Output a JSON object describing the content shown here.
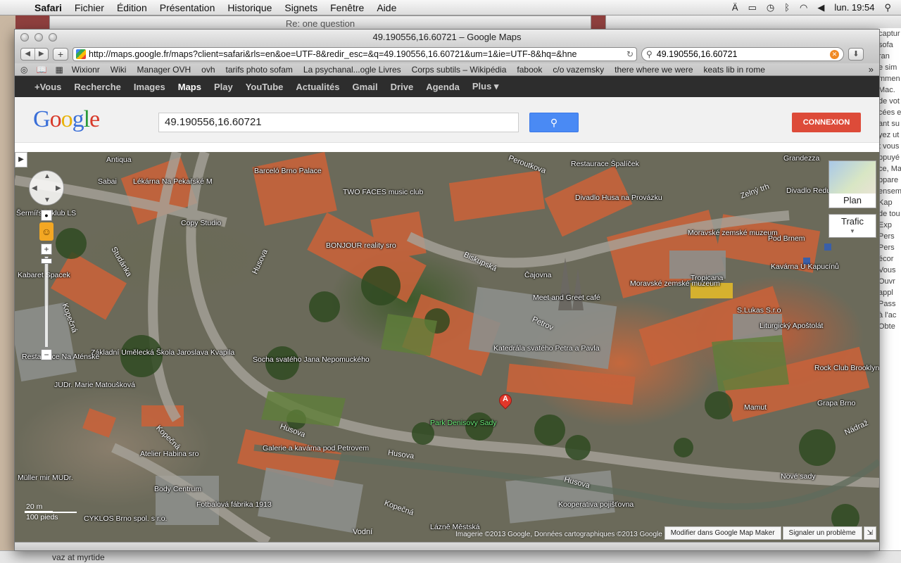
{
  "menubar": {
    "apple": "",
    "items": [
      "Safari",
      "Fichier",
      "Édition",
      "Présentation",
      "Historique",
      "Signets",
      "Fenêtre",
      "Aide"
    ],
    "clock": "lun. 19:54"
  },
  "background": {
    "mid_window_title": "Re: one question",
    "side_text": [
      "captur",
      "sofa",
      "ran",
      "e sim",
      "mmen",
      "Mac.",
      "de vot",
      "cées e",
      "ant su",
      "yez ut",
      "t vous",
      "ppuyé",
      "ce, Ma",
      "ppare",
      "ensemb",
      "Kap",
      "de tou",
      "Exp",
      "Pers",
      "Pers",
      "écor",
      "Vous",
      "Ouvr",
      "appl",
      "Pass",
      "à l'ac",
      "Obte"
    ],
    "bottom_item": "vaz at myrtide"
  },
  "window": {
    "title": "49.190556,16.60721 – Google Maps",
    "url": "http://maps.google.fr/maps?client=safari&rls=en&oe=UTF-8&redir_esc=&q=49.190556,16.60721&um=1&ie=UTF-8&hq=&hne",
    "search_field": "49.190556,16.60721",
    "bookmarks": [
      "Wixionr",
      "Wiki",
      "Manager OVH",
      "ovh",
      "tarifs photo sofam",
      "La psychanal...ogle Livres",
      "Corps subtils – Wikipédia",
      "fabook",
      "c/o vazemsky",
      "there where we were",
      "keats lib in rome"
    ]
  },
  "google_bar": {
    "items": [
      "+Vous",
      "Recherche",
      "Images",
      "Maps",
      "Play",
      "YouTube",
      "Actualités",
      "Gmail",
      "Drive",
      "Agenda",
      "Plus ▾"
    ],
    "active": "Maps"
  },
  "google_header": {
    "logo": "Google",
    "query": "49.190556,16.60721",
    "search_button_icon": "search-icon",
    "connexion": "CONNEXION"
  },
  "map": {
    "marker_letter": "A",
    "plan_label": "Plan",
    "trafic_label": "Trafic",
    "scale_m": "20 m",
    "scale_ft": "100 pieds",
    "attribution": "Imagerie ©2013 Google, Données cartographiques ©2013 Google -",
    "map_maker": "Modifier dans Google Map Maker",
    "report": "Signaler un problème",
    "places": [
      "Antiqua",
      "Sabai",
      "Lékárna Na Pekařské M",
      "Barceló Brno Palace",
      "TWO FACES music club",
      "Restaurace Špalíček",
      "Grandezza",
      "Peroutkova",
      "Divadlo Husa na Provázku",
      "Divadlo Reduta",
      "Zelný trh",
      "Šermířský klub LS",
      "Copy Studio",
      "BONJOUR reality sro",
      "Moravské zemské muzeum",
      "Pod Brnem",
      "Kavárna U Kapucínů",
      "Kabaret Spacek",
      "Studánka",
      "Husova",
      "Biskupská",
      "Čajovna",
      "Meet and Greet café",
      "Moravské zemské muzeum",
      "Tropicana",
      "S.Lukas S.r.o",
      "Liturgický Apoštolát",
      "Petrov",
      "Kopečná",
      "Základní Umělecká Škola Jaroslava Kvapila",
      "Restaurace Na Aténské",
      "Socha svatého Jana Nepomuckého",
      "Katedrála svatého Petra a Pavla",
      "Rock Club Brooklyn",
      "JUDr. Marie Matoušková",
      "Park Denisovy Sady",
      "Mamut",
      "Grapa Brno",
      "Galerie a kavárna pod Petrovem",
      "Atelier Habina sro",
      "Nové sady",
      "Müller mir MUDr.",
      "Body Centrum",
      "Fotbalová fábrika 1913",
      "Kooperativa pojišťovna",
      "CYKLOS Brno spol. s r.o.",
      "Vodní",
      "Lázně Městská",
      "Nádraž"
    ]
  }
}
